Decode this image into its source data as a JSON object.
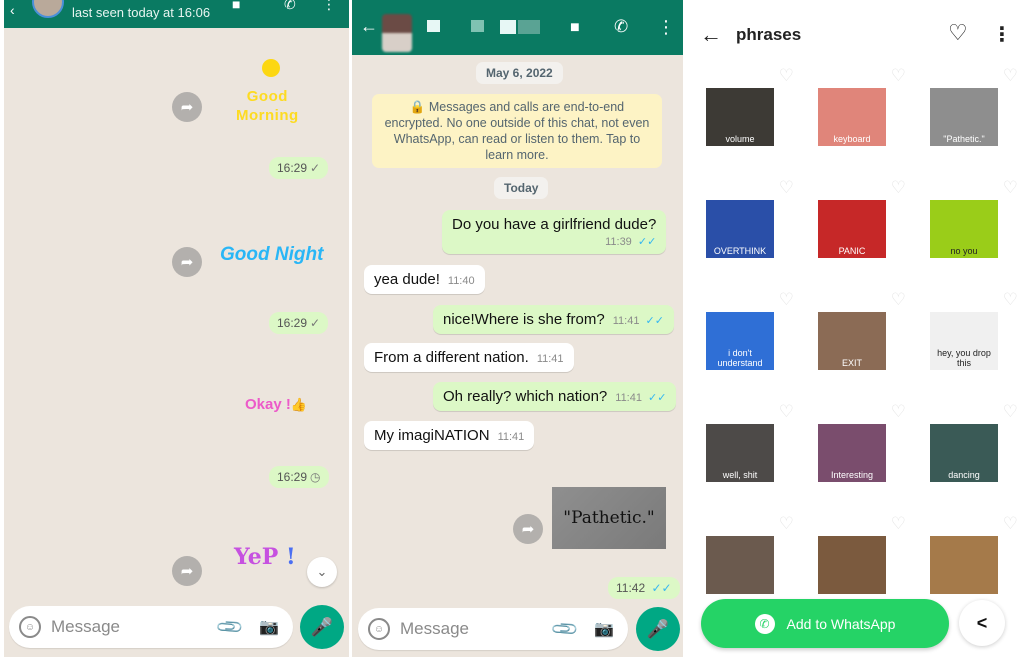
{
  "left_chat": {
    "header": {
      "subtitle": "last seen today at 16:06",
      "back_icon": "‹",
      "video_icon": "■",
      "call_icon": "✆",
      "more_icon": "⋮"
    },
    "stickers": [
      {
        "type": "sticker",
        "text_line1": "Good",
        "text_line2": "Morning",
        "time": "16:29",
        "status": "sent-single-tick"
      },
      {
        "type": "sticker",
        "text": "Good Night",
        "time": "16:29",
        "status": "sent-single-tick"
      },
      {
        "type": "sticker",
        "text": "Okay !",
        "emoji": "👍",
        "time": "16:29",
        "status": "pending-clock"
      },
      {
        "type": "sticker",
        "text": "YeP",
        "exclaim": "!"
      }
    ],
    "forward_icon": "➦",
    "scroll_down_icon": "⌄",
    "tick": "✓",
    "clock": "◷",
    "input": {
      "placeholder": "Message",
      "emoji_icon": "☺",
      "attach_icon": "📎",
      "camera_icon": "📷",
      "mic_icon": "🎤"
    }
  },
  "middle_chat": {
    "header": {
      "back_icon": "←",
      "video_icon": "■",
      "call_icon": "✆",
      "more_icon": "⋮"
    },
    "date_chip": "May 6, 2022",
    "e2e_notice": "🔒 Messages and calls are end-to-end encrypted. No one outside of this chat, not even WhatsApp, can read or listen to them. Tap to learn more.",
    "today_chip": "Today",
    "messages": [
      {
        "dir": "out",
        "text": "Do you have a girlfriend dude?",
        "time": "11:39",
        "status": "read"
      },
      {
        "dir": "in",
        "text": "yea dude!",
        "time": "11:40"
      },
      {
        "dir": "out",
        "text": "nice!Where is she from?",
        "time": "11:41",
        "status": "read"
      },
      {
        "dir": "in",
        "text": "From a different nation.",
        "time": "11:41"
      },
      {
        "dir": "out",
        "text": "Oh really? which nation?",
        "time": "11:41",
        "status": "read"
      },
      {
        "dir": "in",
        "text": "My imagiNATION",
        "time": "11:41"
      },
      {
        "dir": "out",
        "type": "sticker",
        "text": "\"Pathetic.\"",
        "time": "11:42",
        "status": "read"
      }
    ],
    "double_tick": "✓✓",
    "forward_icon": "➦",
    "input": {
      "placeholder": "Message",
      "emoji_icon": "☺",
      "attach_icon": "📎",
      "camera_icon": "📷",
      "mic_icon": "🎤"
    }
  },
  "sticker_pack": {
    "back_icon": "←",
    "title": "phrases",
    "heart_icon": "♡",
    "more_icon": "⋮",
    "stickers": [
      {
        "label": "volume",
        "bg": "#3d3a35"
      },
      {
        "label": "keyboard",
        "bg": "#e0857a"
      },
      {
        "label": "\"Pathetic.\"",
        "bg": "#8e8e8e"
      },
      {
        "label": "OVERTHINK",
        "bg": "#2a4fa8"
      },
      {
        "label": "PANIC",
        "bg": "#c62828"
      },
      {
        "label": "no you",
        "bg": "#9acd19"
      },
      {
        "label": "i don't understand",
        "bg": "#2f6fd6"
      },
      {
        "label": "EXIT",
        "bg": "#8b6b55"
      },
      {
        "label": "hey, you drop this",
        "bg": "#f0f0f0"
      },
      {
        "label": "well, shit",
        "bg": "#4d4a48"
      },
      {
        "label": "Interesting",
        "bg": "#7a4d6d"
      },
      {
        "label": "dancing",
        "bg": "#3a5a56"
      },
      {
        "label": "",
        "bg": "#6b5a4e"
      },
      {
        "label": "",
        "bg": "#7b5a3e"
      },
      {
        "label": "",
        "bg": "#a57a4a"
      }
    ],
    "add_button": {
      "label": "Add to WhatsApp",
      "icon": "✆"
    },
    "share_icon": "<"
  }
}
